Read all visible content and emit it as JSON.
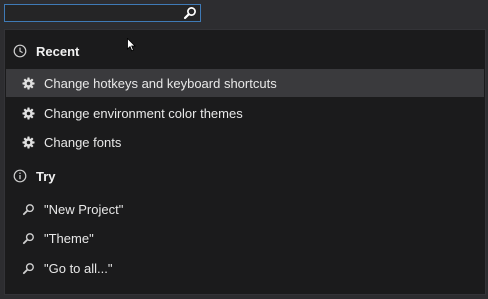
{
  "search": {
    "value": "",
    "placeholder": ""
  },
  "recent": {
    "header": "Recent",
    "header_icon": "clock-icon",
    "items": [
      {
        "label": "Change hotkeys and keyboard shortcuts",
        "icon": "gear-icon",
        "selected": true
      },
      {
        "label": "Change environment color themes",
        "icon": "gear-icon",
        "selected": false
      },
      {
        "label": "Change fonts",
        "icon": "gear-icon",
        "selected": false
      }
    ]
  },
  "try": {
    "header": "Try",
    "header_icon": "info-icon",
    "items": [
      {
        "label": "\"New Project\"",
        "icon": "search-icon"
      },
      {
        "label": "\"Theme\"",
        "icon": "search-icon"
      },
      {
        "label": "\"Go to all...\"",
        "icon": "search-icon"
      }
    ]
  },
  "colors": {
    "background": "#2d2d30",
    "popup_background": "#1b1b1c",
    "selected_row": "#3a3a3d",
    "search_border": "#3f7ab6",
    "text": "#f1f1f1"
  }
}
